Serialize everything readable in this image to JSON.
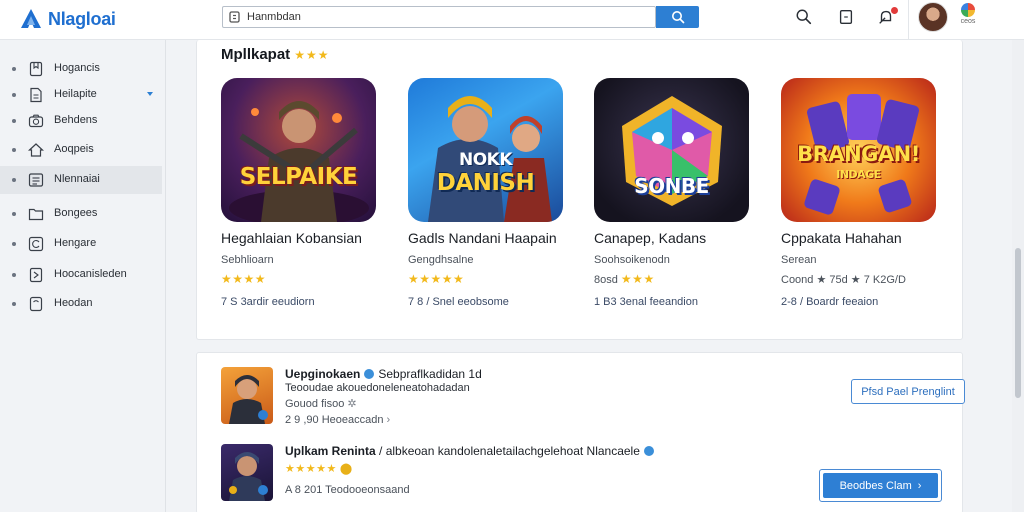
{
  "app": {
    "name": "Nlagloai",
    "brand_color": "#1f6fd0"
  },
  "search": {
    "value": "Hanmbdan",
    "placeholder": ""
  },
  "header": {
    "account_label": "ceos"
  },
  "sidebar": {
    "items": [
      {
        "label": "Hogancis",
        "icon": "bookmark-icon"
      },
      {
        "label": "Heilapite",
        "icon": "document-icon",
        "expanded": true
      },
      {
        "label": "Behdens",
        "icon": "camera-icon"
      },
      {
        "label": "Aoqpeis",
        "icon": "home-icon"
      },
      {
        "label": "Nlennaiai",
        "icon": "list-icon",
        "active": true
      },
      {
        "label": "Bongees",
        "icon": "folder-icon"
      },
      {
        "label": "Hengare",
        "icon": "refresh-icon"
      },
      {
        "label": "Hoocanisleden",
        "icon": "bookmark-icon"
      },
      {
        "label": "Heodan",
        "icon": "tablet-icon"
      }
    ]
  },
  "featured": {
    "title": "Mpllkapat",
    "title_stars": "★★★",
    "games": [
      {
        "art_text": "SELPAIKE",
        "title": "Hegahlaian Kobansian",
        "developer": "Sebhlioarn",
        "rating_prefix": "",
        "stars": "★★★★",
        "meta": "7 S 3ardir eeudiorn"
      },
      {
        "art_text_top": "NOKK",
        "art_text": "DANISH",
        "title": "Gadls Nandani Haapain",
        "developer": "Gengdhsalne",
        "rating_prefix": "",
        "stars": "★★★★★",
        "meta": "7 8 / Snel eeobsome"
      },
      {
        "art_text": "SONBE",
        "title": "Canapep, Kadans",
        "developer": "Soohsoikenodn",
        "rating_prefix": "8osd",
        "stars": "★★★",
        "meta": "1 B3 3enal feeandion"
      },
      {
        "art_text": "BRANGAN!",
        "art_text_sub": "INDAGE",
        "title": "Cppakata Hahahan",
        "developer": "Serean",
        "rating_prefix": "Coond ★ 75d ★ 7 K2G/D",
        "stars": "",
        "meta": "2-8 / Boardr feeaion"
      }
    ]
  },
  "list": {
    "rows": [
      {
        "title": "Uepginokaen",
        "title_suffix": "Sebpraflkadidan 1d",
        "line2": "Teooudae akouedoneleneatohadadan",
        "line3": "Gouod fisoo",
        "line4": "2 9 ,90 Heoeaccadn",
        "button_label": "Pfsd Pael Prenglint"
      },
      {
        "title": "Uplkam Reninta",
        "title_suffix": "/ albkeoan kandolenaletailachgelehoat Nlancaele",
        "stars": "★★★★★",
        "line3": "A 8 201 Teodooeonsaand",
        "button_label": "Beodbes Clam"
      }
    ]
  }
}
